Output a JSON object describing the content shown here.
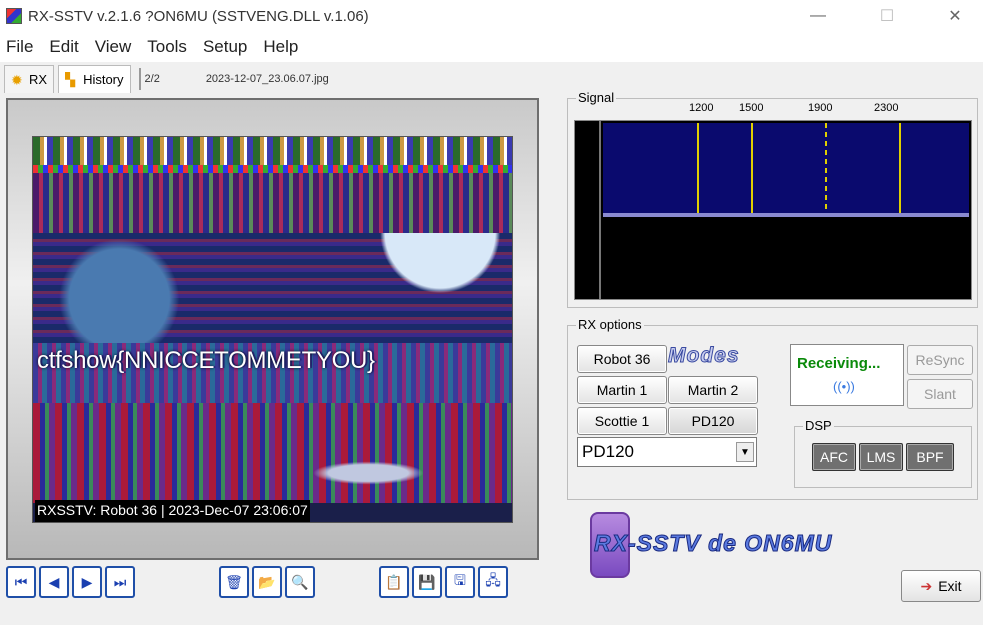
{
  "window": {
    "title": "RX-SSTV v.2.1.6 ?ON6MU (SSTVENG.DLL v.1.06)",
    "minimize": "—",
    "maximize": "☐",
    "close": "✕"
  },
  "menu": [
    "File",
    "Edit",
    "View",
    "Tools",
    "Setup",
    "Help"
  ],
  "tabs": {
    "rx": "RX",
    "history": "History",
    "pager": "2/2",
    "filename": "2023-12-07_23.06.07.jpg"
  },
  "image": {
    "overlay_text": "ctfshow{NNICCETOMMETYOU}",
    "caption": "RXSSTV: Robot 36 | 2023-Dec-07 23:06:07"
  },
  "nav_buttons": [
    {
      "name": "first-image-button",
      "glyph": "⏮"
    },
    {
      "name": "prev-image-button",
      "glyph": "◀"
    },
    {
      "name": "next-image-button",
      "glyph": "▶"
    },
    {
      "name": "last-image-button",
      "glyph": "⏭"
    }
  ],
  "tool_buttons": [
    {
      "name": "delete-button",
      "glyph": "🗑"
    },
    {
      "name": "open-folder-button",
      "glyph": "📂"
    },
    {
      "name": "zoom-button",
      "glyph": "🔍"
    }
  ],
  "file_buttons": [
    {
      "name": "copy-button",
      "glyph": "📋"
    },
    {
      "name": "save-button",
      "glyph": "💾"
    },
    {
      "name": "save-as-button",
      "glyph": "🖫"
    },
    {
      "name": "settings-button",
      "glyph": "🖧"
    }
  ],
  "signal": {
    "label": "Signal",
    "frequencies": [
      "1200",
      "1500",
      "1900",
      "2300"
    ],
    "line_color": "#e0d000",
    "spectrum_color": "#0a0a6e"
  },
  "rx_options": {
    "label": "RX options",
    "modes_logo": "Modes",
    "modes": [
      "Robot 36",
      "Martin 1",
      "Martin 2",
      "Scottie 1",
      "PD120"
    ],
    "selected_mode": "PD120",
    "dropdown_value": "PD120",
    "status": "Receiving...",
    "resync": "ReSync",
    "slant": "Slant",
    "dsp_label": "DSP",
    "dsp_buttons": [
      "AFC",
      "LMS",
      "BPF"
    ],
    "status_color": "#0a8a0a"
  },
  "brand": {
    "logo": "RX-SSTV de ON6MU"
  },
  "exit_label": "Exit"
}
